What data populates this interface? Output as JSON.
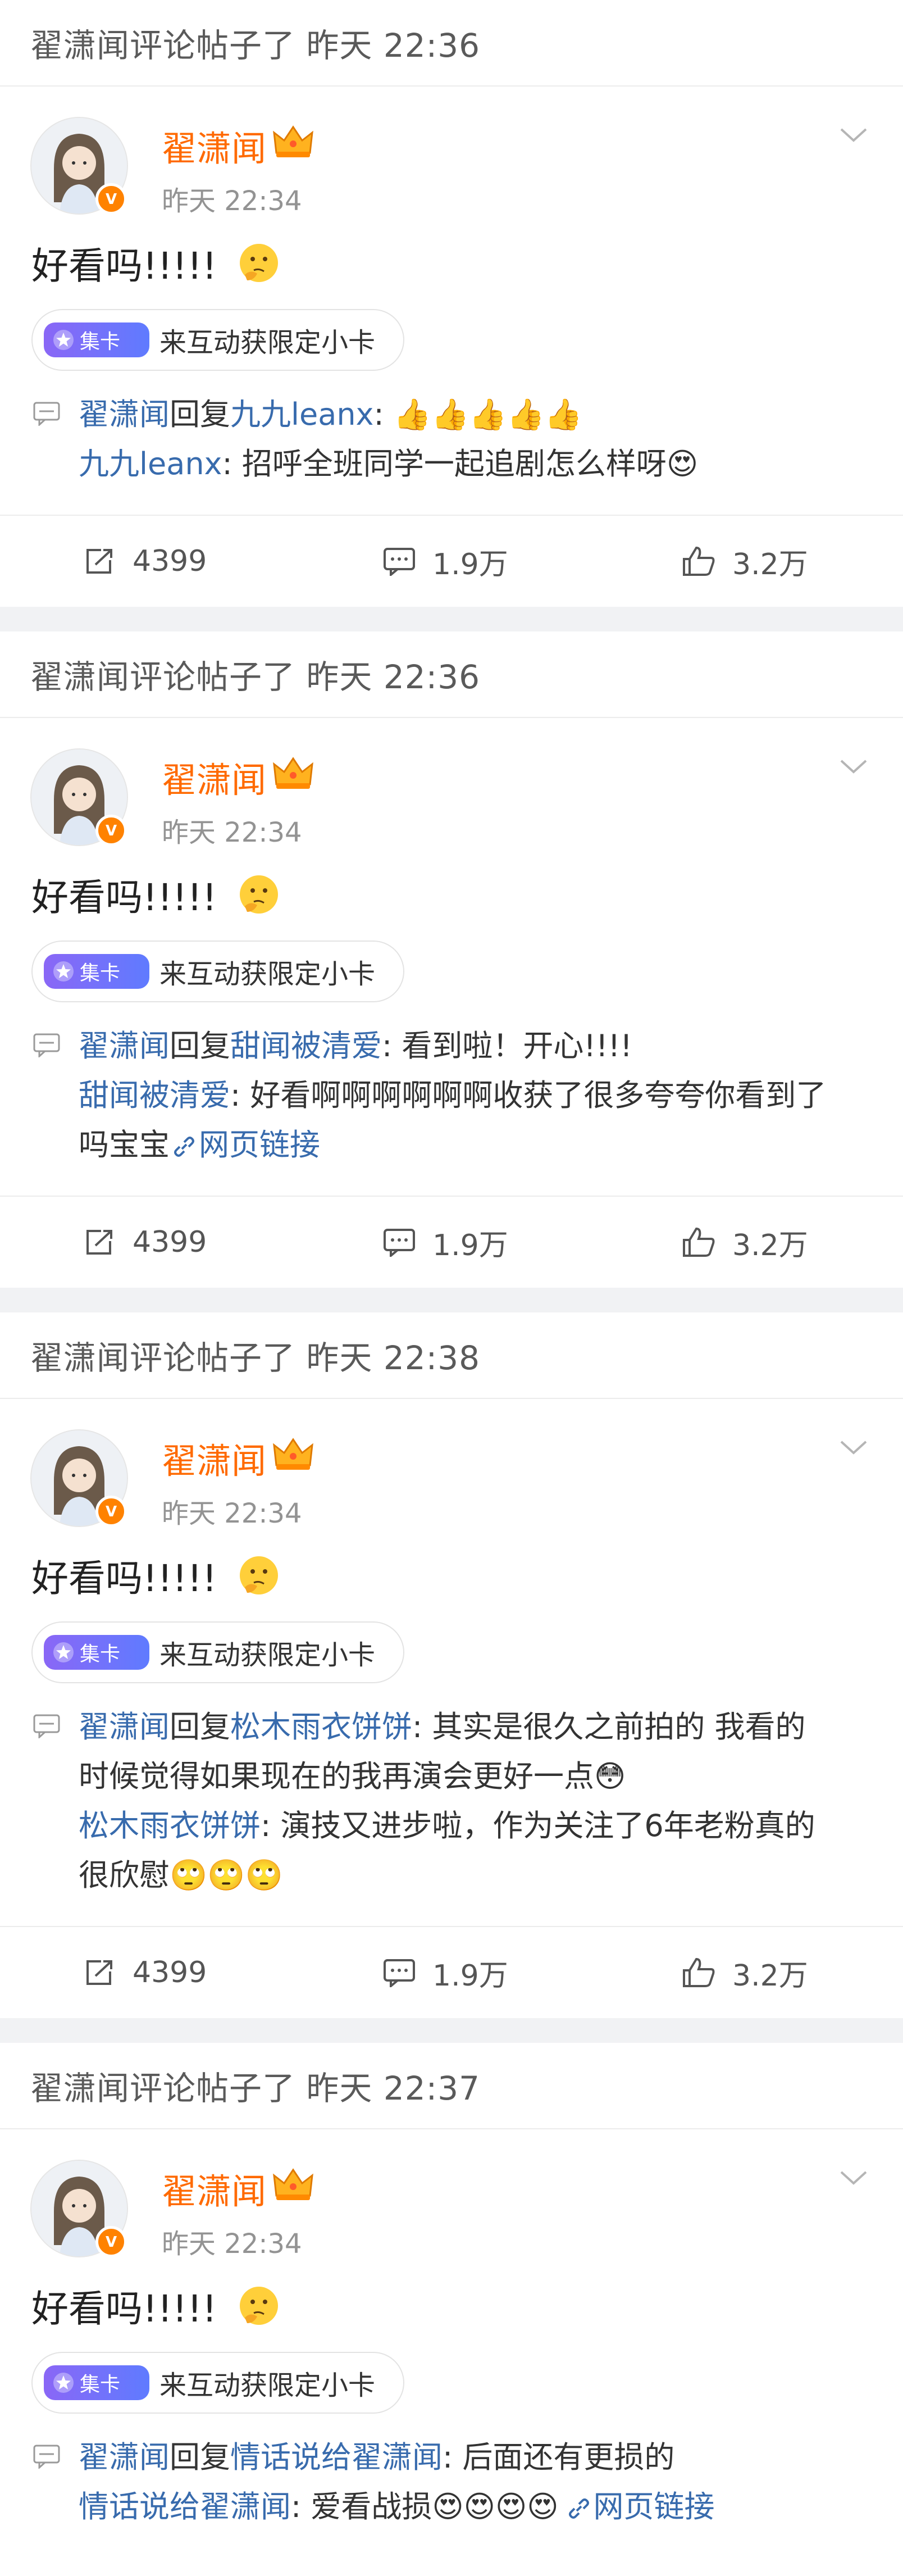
{
  "colors": {
    "accent_orange": "#ff6a00",
    "link_blue": "#386bad",
    "card_badge_purple": "#7a6cf8",
    "separator": "#f1f2f4"
  },
  "cards": [
    {
      "header": "翟潇闻评论帖子了 昨天 22:36",
      "user_name": "翟潇闻",
      "post_time": "昨天 22:34",
      "post_text": "好看吗!!!!!",
      "chip_badge": "集卡",
      "chip_label": "来互动获限定小卡",
      "reply_user": "翟潇闻",
      "reply_word": "回复",
      "reply_target": "九九leanx",
      "reply_content": ": 👍👍👍👍👍",
      "orig_user": "九九leanx",
      "orig_content": ": 招呼全班同学一起追剧怎么样呀😍",
      "orig_extra": "",
      "web_link": "",
      "reposts": "4399",
      "comments": "1.9万",
      "likes": "3.2万"
    },
    {
      "header": "翟潇闻评论帖子了 昨天 22:36",
      "user_name": "翟潇闻",
      "post_time": "昨天 22:34",
      "post_text": "好看吗!!!!!",
      "chip_badge": "集卡",
      "chip_label": "来互动获限定小卡",
      "reply_user": "翟潇闻",
      "reply_word": "回复",
      "reply_target": "甜闻被清爱",
      "reply_content": ": 看到啦！开心!!!!",
      "orig_user": "甜闻被清爱",
      "orig_content": ": 好看啊啊啊啊啊啊收获了很多夸夸你看到了",
      "orig_extra": "吗宝宝",
      "web_link": "网页链接",
      "reposts": "4399",
      "comments": "1.9万",
      "likes": "3.2万"
    },
    {
      "header": "翟潇闻评论帖子了 昨天 22:38",
      "user_name": "翟潇闻",
      "post_time": "昨天 22:34",
      "post_text": "好看吗!!!!!",
      "chip_badge": "集卡",
      "chip_label": "来互动获限定小卡",
      "reply_user": "翟潇闻",
      "reply_word": "回复",
      "reply_target": "松木雨衣饼饼",
      "reply_content": ": 其实是很久之前拍的 我看的",
      "reply_content2": "时候觉得如果现在的我再演会更好一点😳",
      "orig_user": "松木雨衣饼饼",
      "orig_content": ": 演技又进步啦，作为关注了6年老粉真的",
      "orig_extra": "很欣慰🙄🙄🙄",
      "web_link": "",
      "reposts": "4399",
      "comments": "1.9万",
      "likes": "3.2万"
    },
    {
      "header": "翟潇闻评论帖子了 昨天 22:37",
      "user_name": "翟潇闻",
      "post_time": "昨天 22:34",
      "post_text": "好看吗!!!!!",
      "chip_badge": "集卡",
      "chip_label": "来互动获限定小卡",
      "reply_user": "翟潇闻",
      "reply_word": "回复",
      "reply_target": "情话说给翟潇闻",
      "reply_content": ": 后面还有更损的",
      "orig_user": "情话说给翟潇闻",
      "orig_content": ": 爱看战损😍😍😍😍",
      "orig_extra": "",
      "web_link": "网页链接",
      "reposts": "",
      "comments": "",
      "likes": ""
    }
  ]
}
